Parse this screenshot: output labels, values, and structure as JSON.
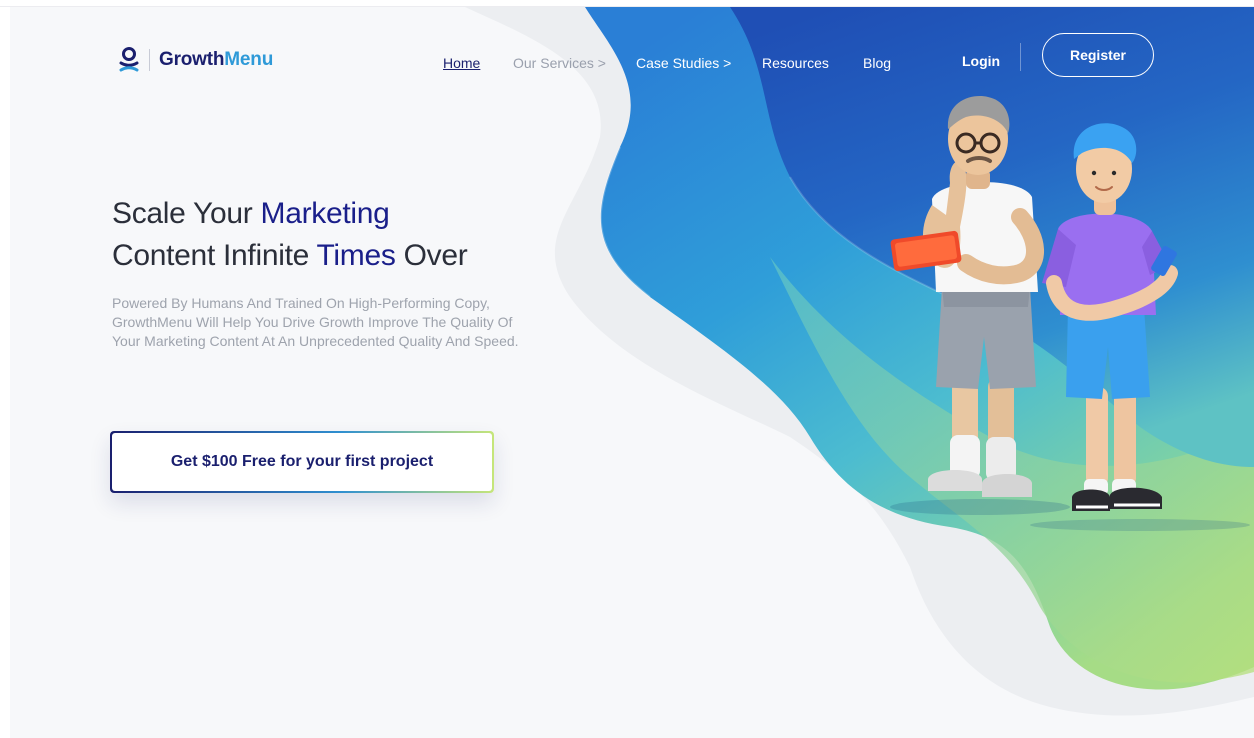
{
  "brand": {
    "name_part1": "Growth",
    "name_part2": "Menu",
    "logo_icon": "person-pin-icon",
    "colors": {
      "navy": "#1a1f6e",
      "blue": "#2f9ad8",
      "green": "#a9dc7e"
    }
  },
  "nav": {
    "home": "Home",
    "services": "Our Services >",
    "case_studies": "Case Studies >",
    "resources": "Resources",
    "blog": "Blog",
    "login": "Login",
    "register": "Register"
  },
  "hero": {
    "title_1": "Scale Your ",
    "title_2": "Marketing",
    "title_3": "Content Infinite ",
    "title_4": "Times",
    "title_5": " Over",
    "description": "Powered By Humans And Trained On High-Performing Copy, GrowthMenu Will Help You Drive Growth Improve The Quality Of Your Marketing Content At An Unprecedented Quality And Speed.",
    "cta": "Get $100 Free for your first project"
  },
  "illustration": {
    "subject": "two 3D characters - older man with glasses holding a tablet, young man with blue hair holding a phone"
  }
}
